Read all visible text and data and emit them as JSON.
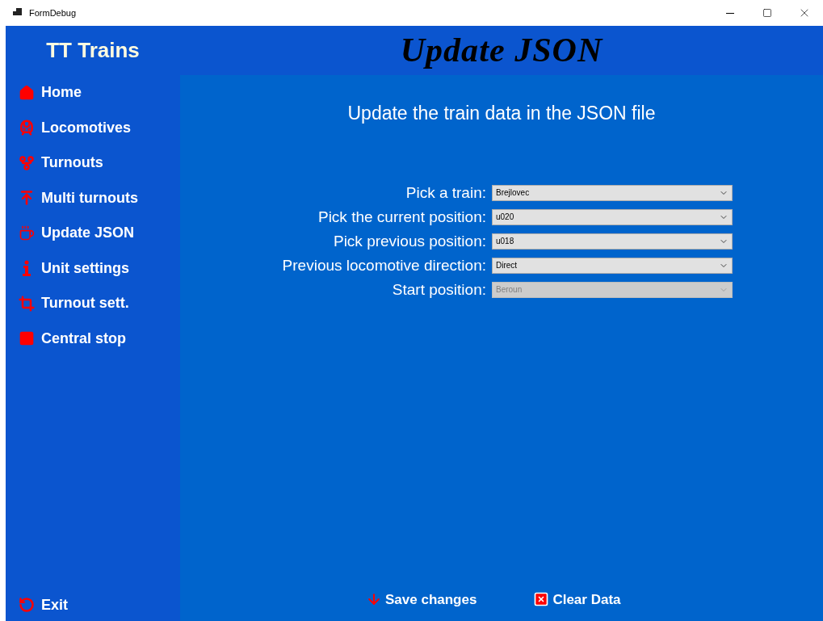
{
  "window": {
    "title": "FormDebug"
  },
  "sidebar": {
    "brand": "TT Trains",
    "items": [
      {
        "label": "Home"
      },
      {
        "label": "Locomotives"
      },
      {
        "label": "Turnouts"
      },
      {
        "label": "Multi turnouts"
      },
      {
        "label": "Update JSON"
      },
      {
        "label": "Unit settings"
      },
      {
        "label": "Turnout sett."
      },
      {
        "label": "Central stop"
      }
    ],
    "exit": "Exit"
  },
  "header": {
    "title": "Update JSON"
  },
  "content": {
    "heading": "Update the train data in the JSON file",
    "fields": [
      {
        "label": "Pick a train:",
        "value": "Brejlovec",
        "disabled": false
      },
      {
        "label": "Pick the current position:",
        "value": "u020",
        "disabled": false
      },
      {
        "label": "Pick previous position:",
        "value": "u018",
        "disabled": false
      },
      {
        "label": "Previous locomotive direction:",
        "value": "Direct",
        "disabled": false
      },
      {
        "label": "Start position:",
        "value": "Beroun",
        "disabled": true
      }
    ],
    "buttons": [
      {
        "label": "Save changes"
      },
      {
        "label": "Clear Data"
      }
    ]
  }
}
